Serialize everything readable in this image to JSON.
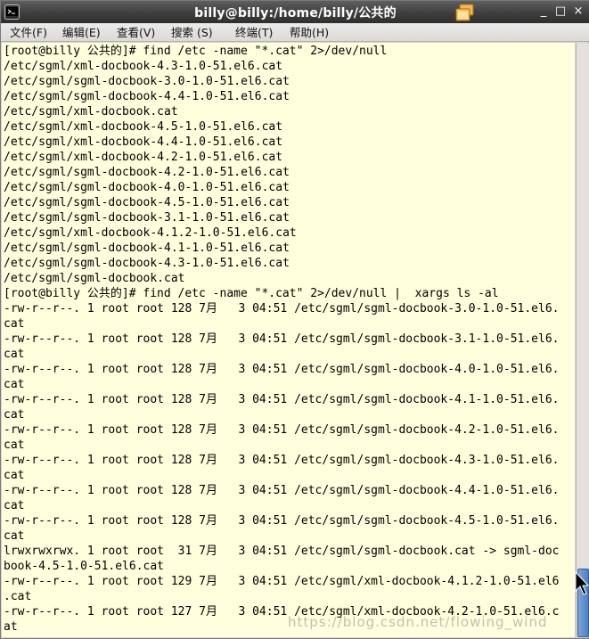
{
  "window": {
    "title": "billy@billy:/home/billy/公共的",
    "controls": {
      "minimize": "_",
      "maximize": "□",
      "close": "×"
    }
  },
  "menu": {
    "items": [
      "文件(F)",
      "编辑(E)",
      "查看(V)",
      "搜索 (S)",
      "终端(T)",
      "帮助(H)"
    ]
  },
  "terminal": {
    "lines": [
      "[root@billy 公共的]# find /etc -name \"*.cat\" 2>/dev/null",
      "/etc/sgml/xml-docbook-4.3-1.0-51.el6.cat",
      "/etc/sgml/sgml-docbook-3.0-1.0-51.el6.cat",
      "/etc/sgml/sgml-docbook-4.4-1.0-51.el6.cat",
      "/etc/sgml/xml-docbook.cat",
      "/etc/sgml/xml-docbook-4.5-1.0-51.el6.cat",
      "/etc/sgml/xml-docbook-4.4-1.0-51.el6.cat",
      "/etc/sgml/xml-docbook-4.2-1.0-51.el6.cat",
      "/etc/sgml/sgml-docbook-4.2-1.0-51.el6.cat",
      "/etc/sgml/sgml-docbook-4.0-1.0-51.el6.cat",
      "/etc/sgml/sgml-docbook-4.5-1.0-51.el6.cat",
      "/etc/sgml/sgml-docbook-3.1-1.0-51.el6.cat",
      "/etc/sgml/xml-docbook-4.1.2-1.0-51.el6.cat",
      "/etc/sgml/sgml-docbook-4.1-1.0-51.el6.cat",
      "/etc/sgml/sgml-docbook-4.3-1.0-51.el6.cat",
      "/etc/sgml/sgml-docbook.cat",
      "[root@billy 公共的]# find /etc -name \"*.cat\" 2>/dev/null |  xargs ls -al",
      "-rw-r--r--. 1 root root 128 7月   3 04:51 /etc/sgml/sgml-docbook-3.0-1.0-51.el6.",
      "cat",
      "-rw-r--r--. 1 root root 128 7月   3 04:51 /etc/sgml/sgml-docbook-3.1-1.0-51.el6.",
      "cat",
      "-rw-r--r--. 1 root root 128 7月   3 04:51 /etc/sgml/sgml-docbook-4.0-1.0-51.el6.",
      "cat",
      "-rw-r--r--. 1 root root 128 7月   3 04:51 /etc/sgml/sgml-docbook-4.1-1.0-51.el6.",
      "cat",
      "-rw-r--r--. 1 root root 128 7月   3 04:51 /etc/sgml/sgml-docbook-4.2-1.0-51.el6.",
      "cat",
      "-rw-r--r--. 1 root root 128 7月   3 04:51 /etc/sgml/sgml-docbook-4.3-1.0-51.el6.",
      "cat",
      "-rw-r--r--. 1 root root 128 7月   3 04:51 /etc/sgml/sgml-docbook-4.4-1.0-51.el6.",
      "cat",
      "-rw-r--r--. 1 root root 128 7月   3 04:51 /etc/sgml/sgml-docbook-4.5-1.0-51.el6.",
      "cat",
      "lrwxrwxrwx. 1 root root  31 7月   3 04:51 /etc/sgml/sgml-docbook.cat -> sgml-doc",
      "book-4.5-1.0-51.el6.cat",
      "-rw-r--r--. 1 root root 129 7月   3 04:51 /etc/sgml/xml-docbook-4.1.2-1.0-51.el6",
      ".cat",
      "-rw-r--r--. 1 root root 127 7月   3 04:51 /etc/sgml/xml-docbook-4.2-1.0-51.el6.c",
      "at"
    ]
  },
  "watermark": "https://blog.csdn.net/flowing_wind",
  "colors": {
    "terminal_bg": "#ffffdd",
    "terminal_fg": "#000000",
    "titlebar": "#3e3e3e",
    "scroll_thumb": "#4a7fc4"
  },
  "icons": {
    "app": "terminal-icon",
    "title_decoration": "windows-stack-icon",
    "pointer": "mouse-cursor-icon"
  }
}
